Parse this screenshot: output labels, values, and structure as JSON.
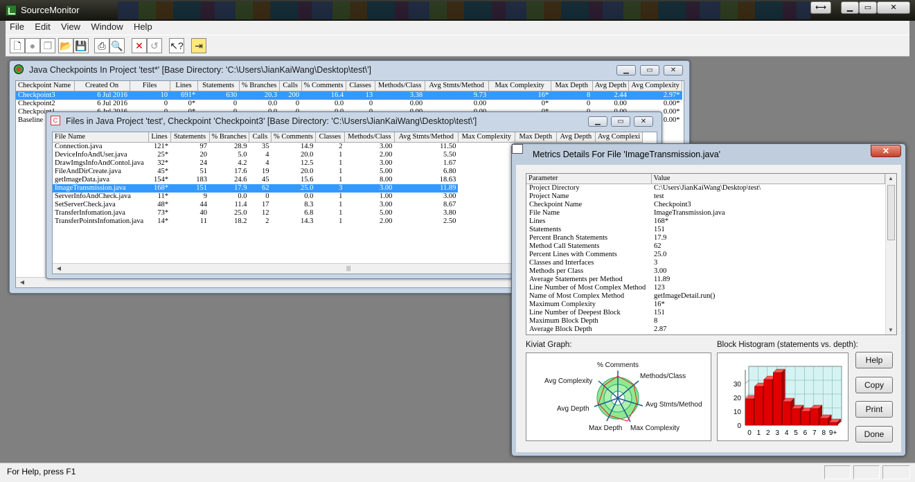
{
  "app": {
    "title": "SourceMonitor"
  },
  "menu": {
    "items": [
      "File",
      "Edit",
      "View",
      "Window",
      "Help"
    ]
  },
  "status": {
    "text": "For Help, press F1"
  },
  "checkpoints": {
    "title": "Java Checkpoints In Project 'test*'  [Base Directory: 'C:\\Users\\JianKaiWang\\Desktop\\test\\']",
    "columns": [
      "Checkpoint Name",
      "Created On",
      "Files",
      "Lines",
      "Statements",
      "% Branches",
      "Calls",
      "% Comments",
      "Classes",
      "Methods/Class",
      "Avg Stmts/Method",
      "Max Complexity",
      "Max Depth",
      "Avg Depth",
      "Avg Complexity"
    ],
    "rows": [
      [
        "Checkpoint3",
        "6 Jul 2016",
        "10",
        "691*",
        "630",
        "20.3",
        "200",
        "16.4",
        "13",
        "3.38",
        "9.73",
        "16*",
        "8",
        "2.44",
        "2.97*"
      ],
      [
        "Checkpoint2",
        "6 Jul 2016",
        "0",
        "0*",
        "0",
        "0.0",
        "0",
        "0.0",
        "0",
        "0.00",
        "0.00",
        "0*",
        "0",
        "0.00",
        "0.00*"
      ],
      [
        "Checkpoint1",
        "6 Jul 2016",
        "0",
        "0*",
        "0",
        "0.0",
        "0",
        "0.0",
        "0",
        "0.00",
        "0.00",
        "0*",
        "0",
        "0.00",
        "0.00*"
      ],
      [
        "Baseline",
        "",
        "",
        "",
        "",
        "",
        "",
        "",
        "",
        "",
        "",
        "",
        "",
        "",
        "0.00*"
      ]
    ]
  },
  "files": {
    "title": "Files in Java Project 'test', Checkpoint 'Checkpoint3'  [Base Directory: 'C:\\Users\\JianKaiWang\\Desktop\\test\\']",
    "columns": [
      "File Name",
      "Lines",
      "Statements",
      "% Branches",
      "Calls",
      "% Comments",
      "Classes",
      "Methods/Class",
      "Avg Stmts/Method",
      "Max Complexity",
      "Max Depth",
      "Avg Depth",
      "Avg Complexi"
    ],
    "rows": [
      [
        "Connection.java",
        "121*",
        "97",
        "28.9",
        "35",
        "14.9",
        "2",
        "3.00",
        "11.50"
      ],
      [
        "DeviceInfoAndUser.java",
        "25*",
        "20",
        "5.0",
        "4",
        "20.0",
        "1",
        "2.00",
        "5.50"
      ],
      [
        "DrawImgsInfoAndContol.java",
        "32*",
        "24",
        "4.2",
        "4",
        "12.5",
        "1",
        "3.00",
        "1.67"
      ],
      [
        "FileAndDirCreate.java",
        "45*",
        "51",
        "17.6",
        "19",
        "20.0",
        "1",
        "5.00",
        "6.80"
      ],
      [
        "getImageData.java",
        "154*",
        "183",
        "24.6",
        "45",
        "15.6",
        "1",
        "8.00",
        "18.63"
      ],
      [
        "ImageTransmission.java",
        "168*",
        "151",
        "17.9",
        "62",
        "25.0",
        "3",
        "3.00",
        "11.89"
      ],
      [
        "ServerInfoAndCheck.java",
        "11*",
        "9",
        "0.0",
        "0",
        "0.0",
        "1",
        "1.00",
        "3.00"
      ],
      [
        "SetServerCheck.java",
        "48*",
        "44",
        "11.4",
        "17",
        "8.3",
        "1",
        "3.00",
        "8.67"
      ],
      [
        "TransferInfomation.java",
        "73*",
        "40",
        "25.0",
        "12",
        "6.8",
        "1",
        "5.00",
        "3.80"
      ],
      [
        "TransferPointsInfomation.java",
        "14*",
        "11",
        "18.2",
        "2",
        "14.3",
        "1",
        "2.00",
        "2.50"
      ]
    ],
    "selected_row": 5
  },
  "metrics": {
    "title": "Metrics Details For File 'ImageTransmission.java'",
    "columns": [
      "Parameter",
      "Value"
    ],
    "rows": [
      [
        "Project Directory",
        "C:\\Users\\JianKaiWang\\Desktop\\test\\"
      ],
      [
        "Project Name",
        "test"
      ],
      [
        "Checkpoint Name",
        "Checkpoint3"
      ],
      [
        "File Name",
        "ImageTransmission.java"
      ],
      [
        "Lines",
        "168*"
      ],
      [
        "Statements",
        "151"
      ],
      [
        "Percent Branch Statements",
        "17.9"
      ],
      [
        "Method Call Statements",
        "62"
      ],
      [
        "Percent Lines with Comments",
        "25.0"
      ],
      [
        "Classes and Interfaces",
        "3"
      ],
      [
        "Methods per Class",
        "3.00"
      ],
      [
        "Average Statements per Method",
        "11.89"
      ],
      [
        "Line Number of Most Complex Method",
        "123"
      ],
      [
        "Name of Most Complex Method",
        "getImageDetail.run()"
      ],
      [
        "Maximum Complexity",
        "16*"
      ],
      [
        "Line Number of Deepest Block",
        "151"
      ],
      [
        "Maximum Block Depth",
        "8"
      ],
      [
        "Average Block Depth",
        "2.87"
      ]
    ],
    "kiviat_label": "Kiviat Graph:",
    "histogram_label": "Block Histogram (statements vs. depth):",
    "kiviat_axes": [
      "% Comments",
      "Methods/Class",
      "Avg Stmts/Method",
      "Max Complexity",
      "Max Depth",
      "Avg Depth",
      "Avg Complexity"
    ],
    "buttons": {
      "help": "Help",
      "copy": "Copy",
      "print": "Print",
      "done": "Done"
    }
  },
  "chart_data": {
    "type": "bar",
    "title": "Block Histogram (statements vs. depth):",
    "categories": [
      "0",
      "1",
      "2",
      "3",
      "4",
      "5",
      "6",
      "7",
      "8",
      "9+"
    ],
    "values": [
      19,
      28,
      33,
      38,
      17,
      12,
      10,
      12,
      5,
      2
    ],
    "yticks": [
      "0",
      "10",
      "20",
      "30"
    ],
    "ylim": [
      0,
      40
    ],
    "color": "#e00000"
  }
}
